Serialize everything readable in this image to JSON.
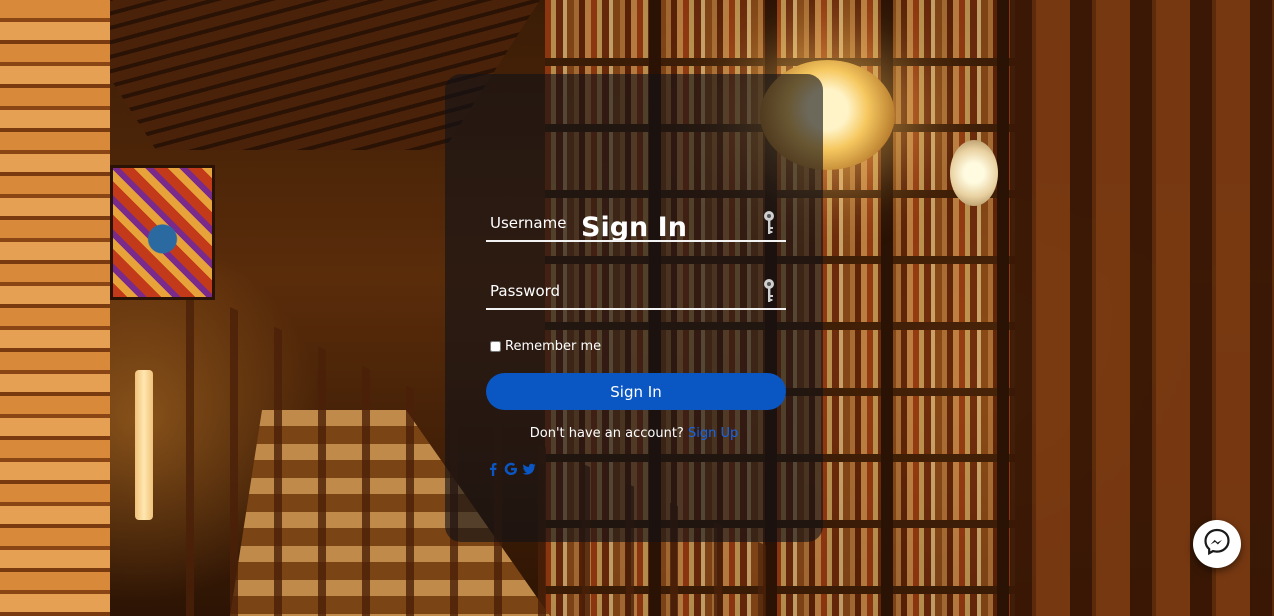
{
  "form": {
    "title": "Sign In",
    "username_placeholder": "Username",
    "password_placeholder": "Password",
    "remember_label": "Remember me",
    "submit_label": "Sign In",
    "signup_prompt": "Don't have an account?",
    "signup_link": "Sign Up"
  },
  "socials": [
    {
      "name": "facebook-icon"
    },
    {
      "name": "google-icon"
    },
    {
      "name": "twitter-icon"
    }
  ],
  "chat": {
    "icon": "messenger-icon"
  },
  "colors": {
    "accent": "#0a56c2",
    "link": "#1565e6",
    "card": "rgba(18,18,22,0.62)"
  }
}
